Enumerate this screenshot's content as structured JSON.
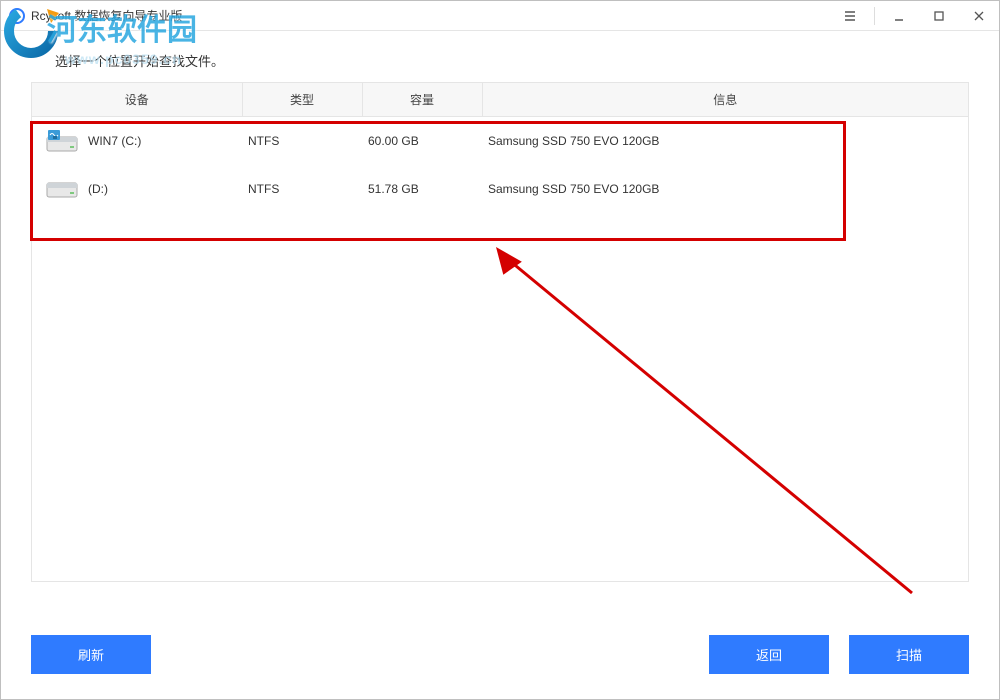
{
  "window": {
    "title": "Rcysoft 数据恢复向导专业版"
  },
  "instruction": "选择一个位置开始查找文件。",
  "columns": {
    "device": "设备",
    "type": "类型",
    "capacity": "容量",
    "info": "信息"
  },
  "drives": [
    {
      "name": "WIN7 (C:)",
      "type": "NTFS",
      "capacity": "60.00 GB",
      "info": "Samsung SSD 750 EVO 120GB",
      "icon": "os-drive"
    },
    {
      "name": "(D:)",
      "type": "NTFS",
      "capacity": "51.78 GB",
      "info": "Samsung SSD 750 EVO 120GB",
      "icon": "data-drive"
    }
  ],
  "buttons": {
    "refresh": "刷新",
    "back": "返回",
    "scan": "扫描"
  },
  "watermark": {
    "text": "河东软件园",
    "url": "www.pc0359.cn"
  }
}
